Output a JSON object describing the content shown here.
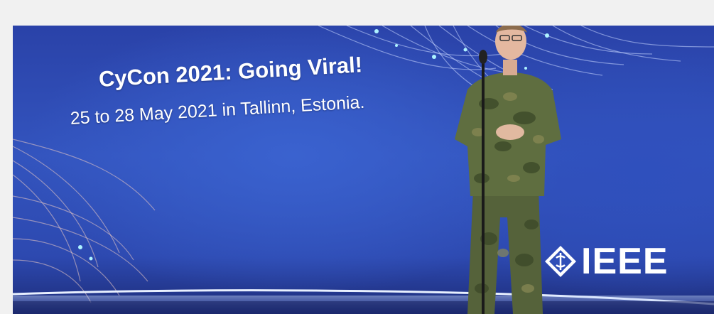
{
  "banner": {
    "headline": "CyCon 2021: Going Viral!",
    "subline": "25 to 28 May 2021 in Tallinn, Estonia.",
    "logo_text": "IEEE"
  },
  "colors": {
    "page_background": "#f1f1f1",
    "stage_blue": "#3354be",
    "text": "#ffffff",
    "uniform_green": "#5b6b3e"
  }
}
